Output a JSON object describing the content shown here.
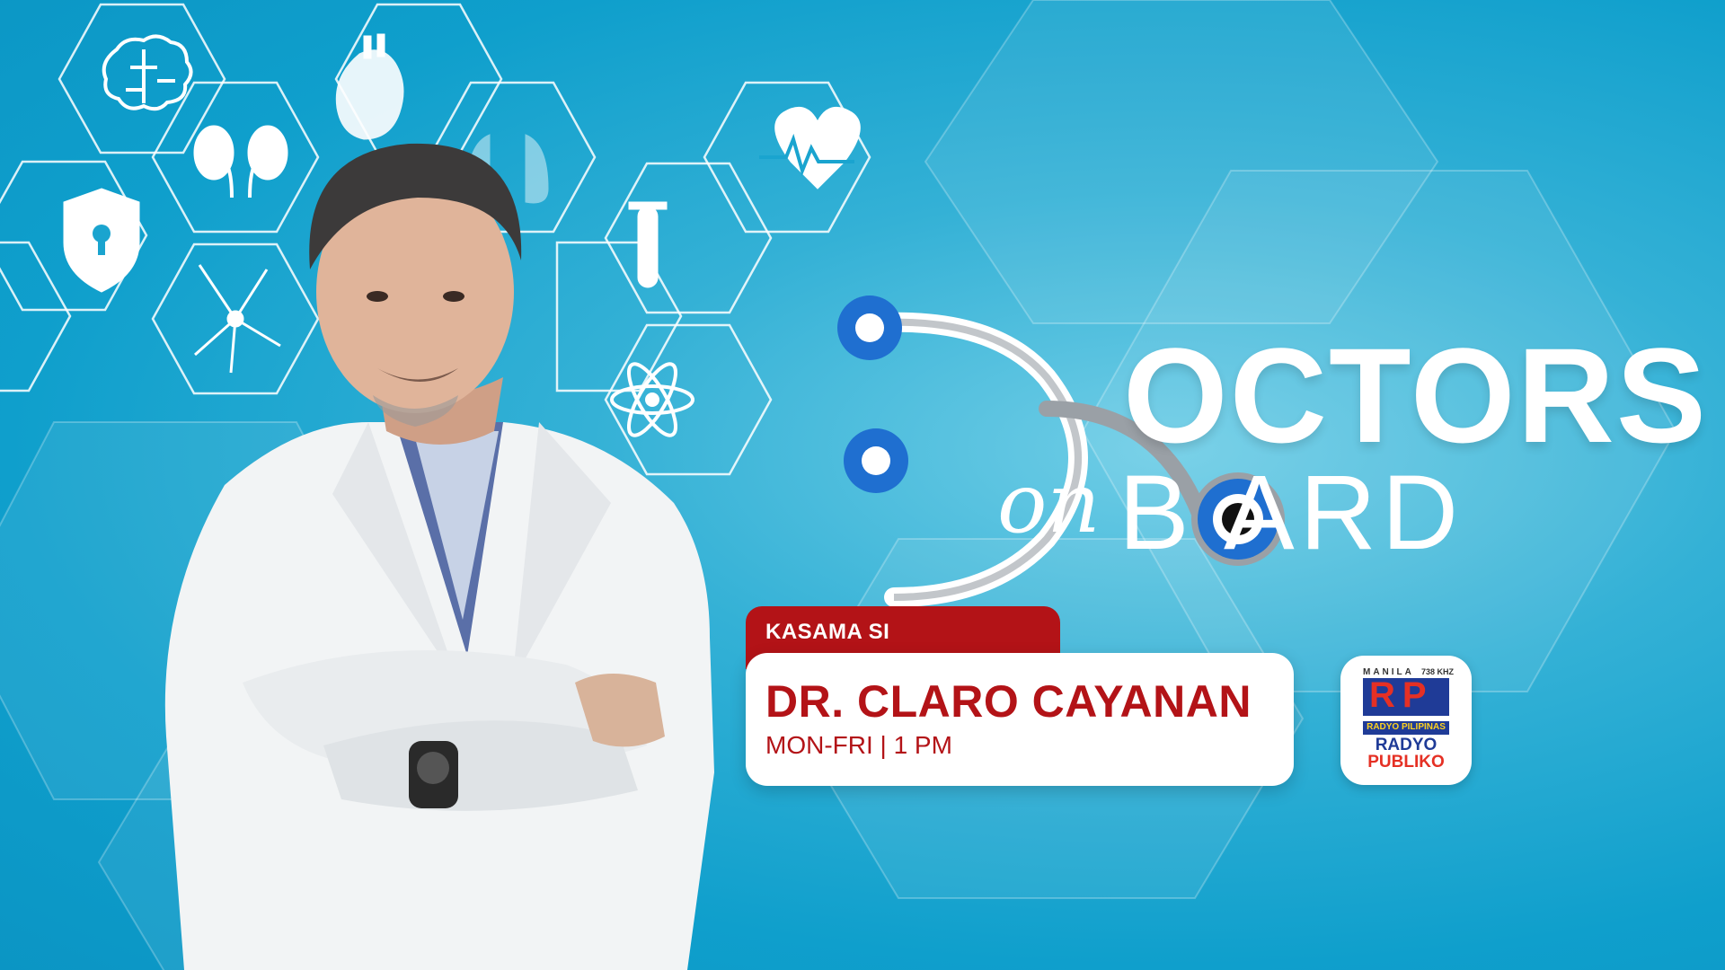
{
  "show": {
    "title_line1": "OCTORS",
    "title_on": "on",
    "title_board": "B  ARD"
  },
  "host": {
    "tab_label": "KASAMA SI",
    "name": "DR. CLARO CAYANAN",
    "schedule": "MON-FRI | 1 PM"
  },
  "station": {
    "city": "MANILA",
    "frequency": "738 KHZ",
    "mark": "RP",
    "network": "RADYO PILIPINAS",
    "brand_line1": "RADYO",
    "brand_line2": "PUBLIKO"
  },
  "colors": {
    "accent_red": "#b31317",
    "accent_blue": "#1f6fd0",
    "background": "#1aa4cf"
  },
  "icons": [
    "brain-icon",
    "heart-organ-icon",
    "kidneys-icon",
    "lungs-icon",
    "heartbeat-icon",
    "shield-lock-icon",
    "neuron-icon",
    "test-tube-icon",
    "atom-icon",
    "stethoscope-icon"
  ]
}
